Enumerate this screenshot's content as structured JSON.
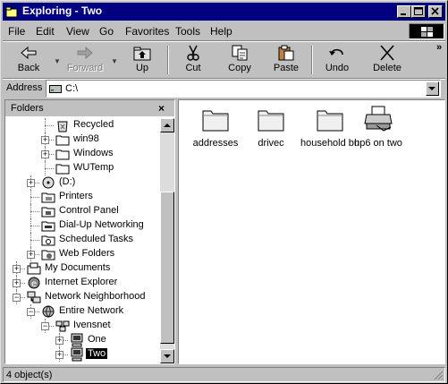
{
  "window": {
    "title": "Exploring - Two"
  },
  "menu": [
    {
      "label": "File",
      "key": "F"
    },
    {
      "label": "Edit",
      "key": "E"
    },
    {
      "label": "View",
      "key": "V"
    },
    {
      "label": "Go",
      "key": "G"
    },
    {
      "label": "Favorites",
      "key": "a"
    },
    {
      "label": "Tools",
      "key": "T"
    },
    {
      "label": "Help",
      "key": "H"
    }
  ],
  "toolbar": {
    "back": "Back",
    "forward": "Forward",
    "up": "Up",
    "cut": "Cut",
    "copy": "Copy",
    "paste": "Paste",
    "undo": "Undo",
    "delete": "Delete",
    "more": "»"
  },
  "address": {
    "label": "Address",
    "value": "C:\\"
  },
  "folders_pane": {
    "title": "Folders",
    "close": "×"
  },
  "tree": [
    {
      "label": "Recycled",
      "icon": "recycle-bin-icon",
      "level": 3,
      "expander": ""
    },
    {
      "label": "win98",
      "icon": "folder-icon",
      "level": 3,
      "expander": "+"
    },
    {
      "label": "Windows",
      "icon": "folder-icon",
      "level": 3,
      "expander": "+"
    },
    {
      "label": "WUTemp",
      "icon": "folder-icon",
      "level": 3,
      "expander": ""
    },
    {
      "label": "(D:)",
      "icon": "cd-drive-icon",
      "level": 2,
      "expander": "+"
    },
    {
      "label": "Printers",
      "icon": "printers-icon",
      "level": 2,
      "expander": ""
    },
    {
      "label": "Control Panel",
      "icon": "control-panel-icon",
      "level": 2,
      "expander": ""
    },
    {
      "label": "Dial-Up Networking",
      "icon": "dialup-icon",
      "level": 2,
      "expander": ""
    },
    {
      "label": "Scheduled Tasks",
      "icon": "scheduled-tasks-icon",
      "level": 2,
      "expander": ""
    },
    {
      "label": "Web Folders",
      "icon": "web-folders-icon",
      "level": 2,
      "expander": "+"
    },
    {
      "label": "My Documents",
      "icon": "my-documents-icon",
      "level": 1,
      "expander": "+"
    },
    {
      "label": "Internet Explorer",
      "icon": "internet-explorer-icon",
      "level": 1,
      "expander": "+"
    },
    {
      "label": "Network Neighborhood",
      "icon": "network-icon",
      "level": 1,
      "expander": "−"
    },
    {
      "label": "Entire Network",
      "icon": "globe-icon",
      "level": 2,
      "expander": "−"
    },
    {
      "label": "Ivensnet",
      "icon": "workgroup-icon",
      "level": 3,
      "expander": "−"
    },
    {
      "label": "One",
      "icon": "computer-icon",
      "level": 4,
      "expander": "+"
    },
    {
      "label": "Two",
      "icon": "computer-icon",
      "level": 4,
      "expander": "+",
      "selected": true
    }
  ],
  "files": [
    {
      "label": "addresses",
      "icon": "folder-icon"
    },
    {
      "label": "drivec",
      "icon": "folder-icon"
    },
    {
      "label": "household bu",
      "icon": "folder-icon"
    },
    {
      "label": "hp6 on two",
      "icon": "printer-icon"
    }
  ],
  "status": {
    "text": "4 object(s)"
  }
}
